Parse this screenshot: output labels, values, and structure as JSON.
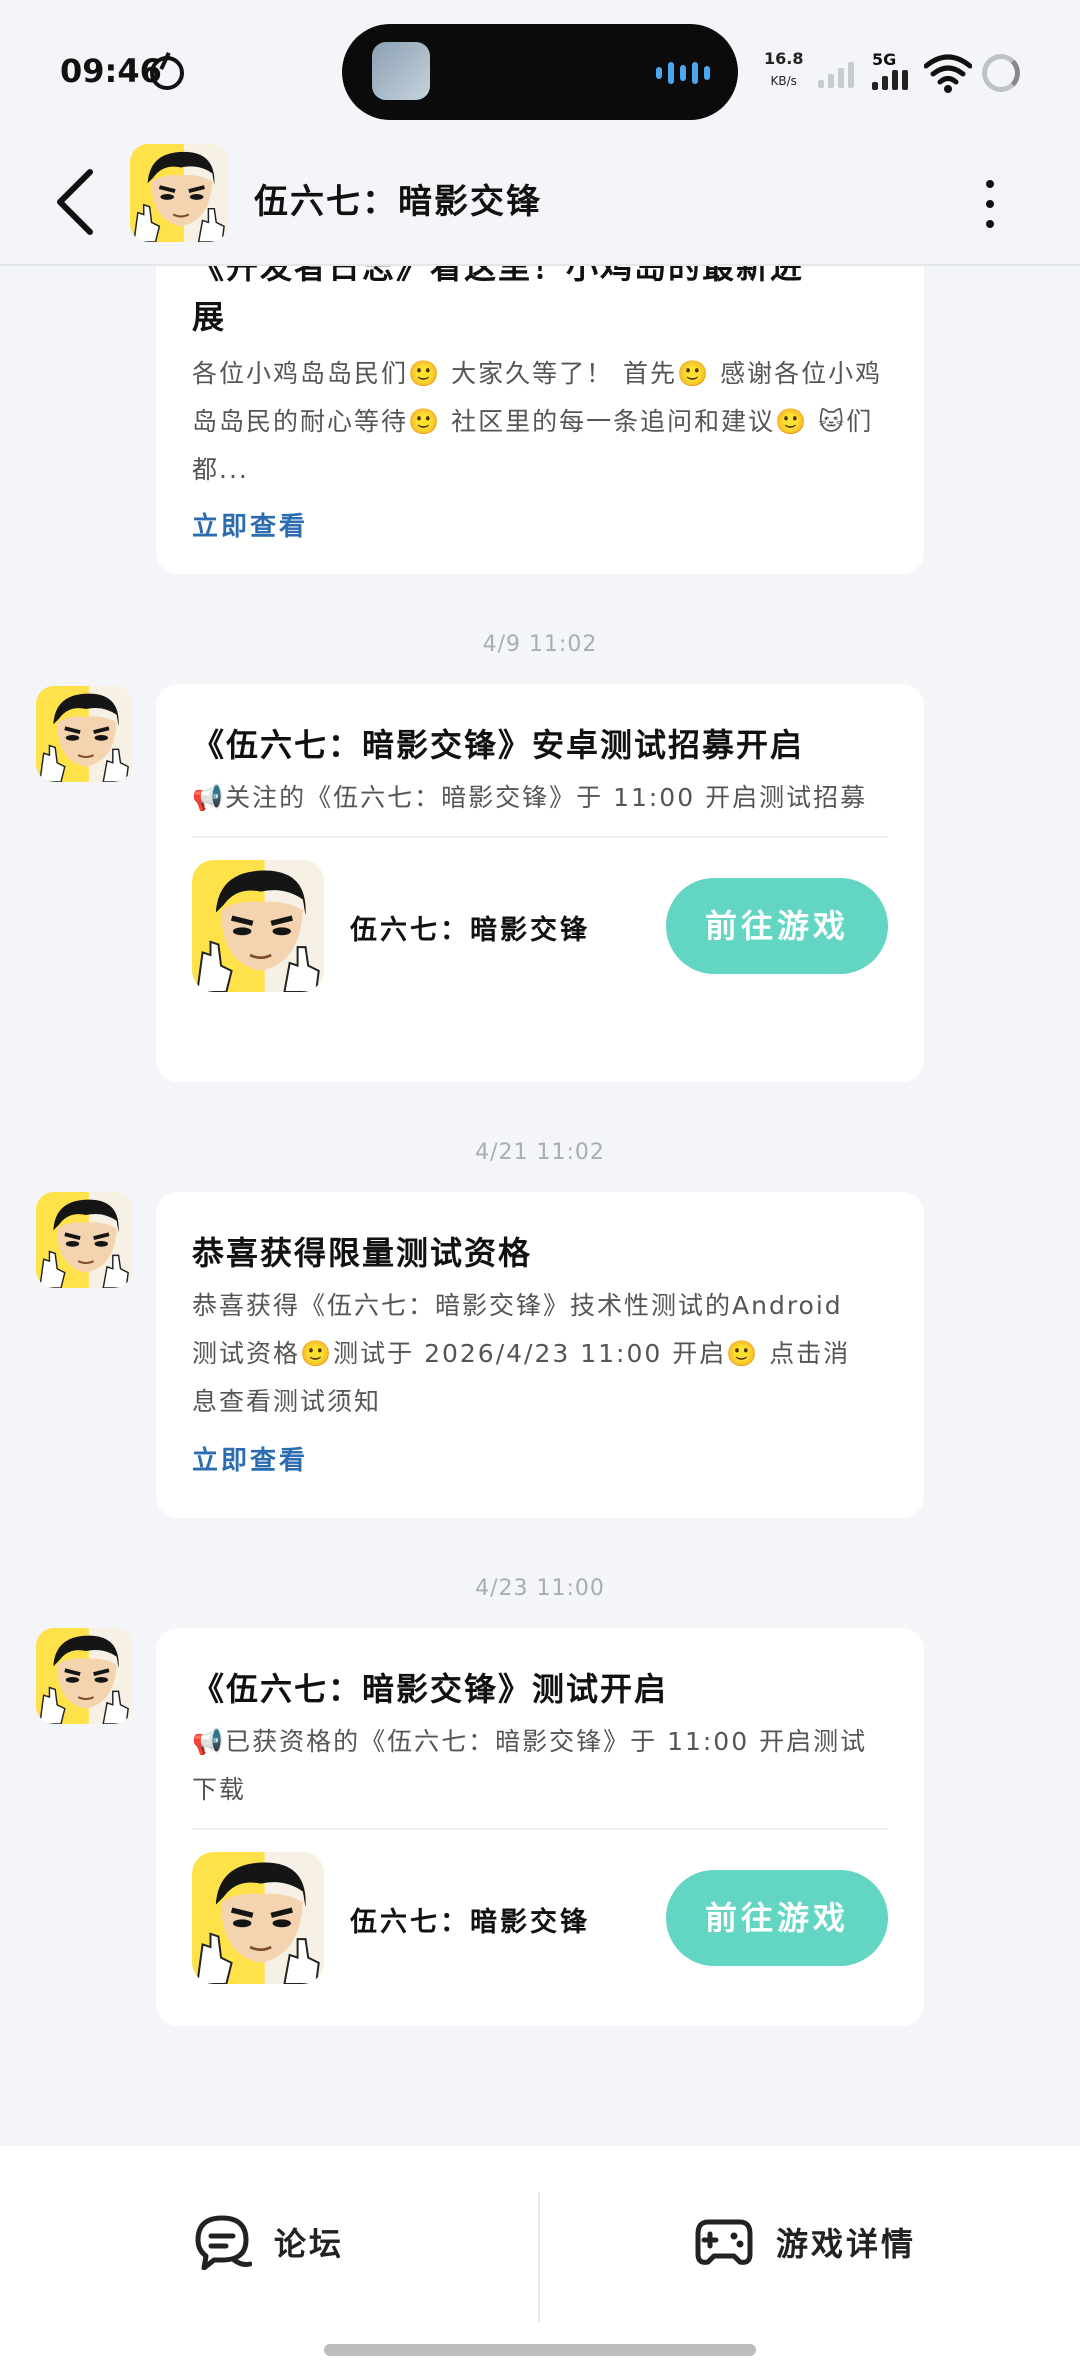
{
  "status_bar": {
    "time": "09:46",
    "net_speed": "16.8",
    "net_unit": "KB/s",
    "network": "5G"
  },
  "header": {
    "title": "伍六七：暗影交锋"
  },
  "messages": [
    {
      "title_line1": "《开发者日志》看这里！小鸡岛的最新进",
      "title_line2": "展",
      "body": "各位小鸡岛岛民们🙂 大家久等了！ 首先🙂 感谢各位小鸡岛岛民的耐心等待🙂 社区里的每一条追问和建议🙂 🐱们都...",
      "link": "立即查看"
    },
    {
      "timestamp": "4/9   11:02",
      "title": "《伍六七：暗影交锋》安卓测试招募开启",
      "body": "📢关注的《伍六七：暗影交锋》于 11:00 开启测试招募",
      "game_name": "伍六七：暗影交锋",
      "button": "前往游戏"
    },
    {
      "timestamp": "4/21   11:02",
      "title": "恭喜获得限量测试资格",
      "body": "恭喜获得《伍六七：暗影交锋》技术性测试的Android测试资格🙂测试于 2026/4/23 11:00 开启🙂 点击消息查看测试须知",
      "link": "立即查看"
    },
    {
      "timestamp": "4/23   11:00",
      "title": "《伍六七：暗影交锋》测试开启",
      "body": "📢已获资格的《伍六七：暗影交锋》于 11:00 开启测试下载",
      "game_name": "伍六七：暗影交锋",
      "button": "前往游戏"
    }
  ],
  "bottom_bar": {
    "forum": "论坛",
    "game_details": "游戏详情"
  },
  "colors": {
    "accent_button": "#62D5C3",
    "link": "#2C6CB0",
    "background": "#F3F5F8"
  }
}
